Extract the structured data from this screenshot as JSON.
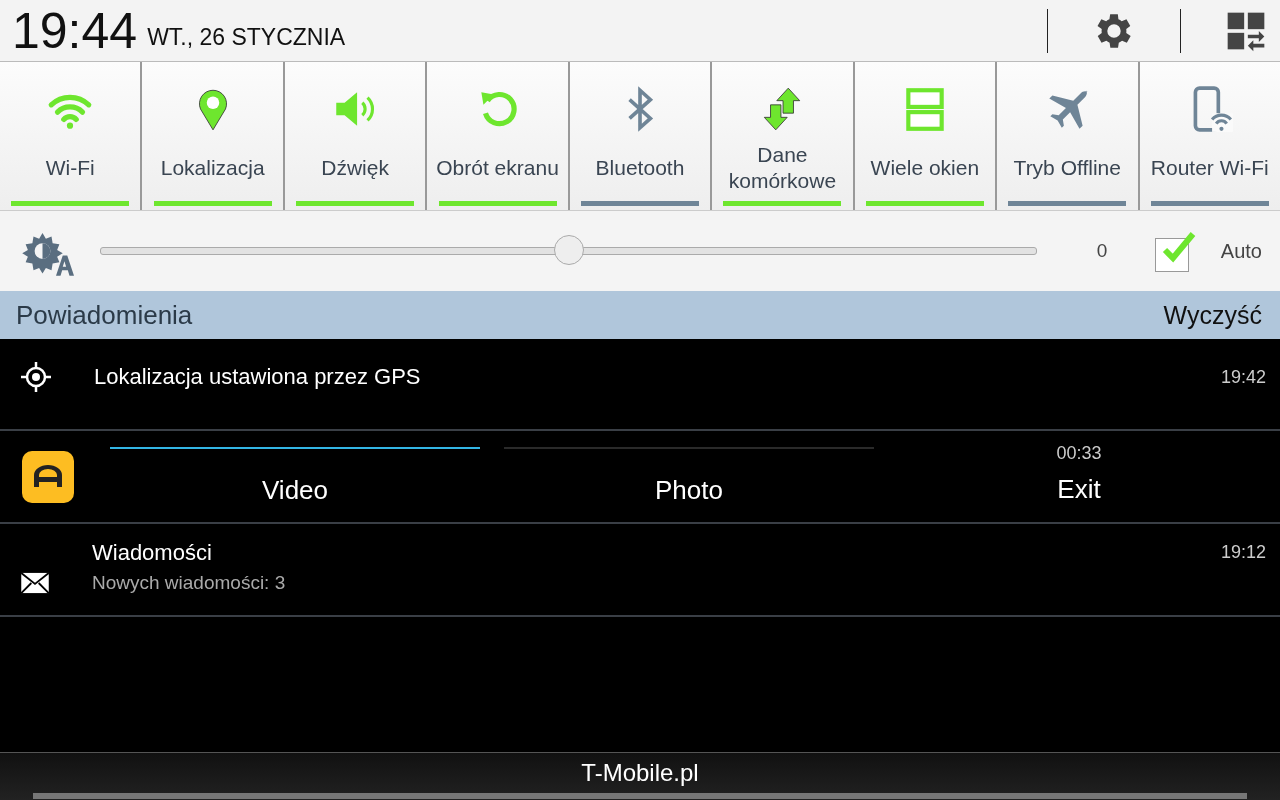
{
  "header": {
    "time": "19:44",
    "date": "WT., 26 STYCZNIA"
  },
  "toggles": [
    {
      "kind": "wifi",
      "label": "Wi-Fi",
      "on": true
    },
    {
      "kind": "location",
      "label": "Lokalizacja",
      "on": true
    },
    {
      "kind": "sound",
      "label": "Dźwięk",
      "on": true
    },
    {
      "kind": "rotate",
      "label": "Obrót ekranu",
      "on": true
    },
    {
      "kind": "bluetooth",
      "label": "Bluetooth",
      "on": false
    },
    {
      "kind": "data",
      "label": "Dane komórkowe",
      "on": true
    },
    {
      "kind": "multiwindow",
      "label": "Wiele okien",
      "on": true
    },
    {
      "kind": "airplane",
      "label": "Tryb Offline",
      "on": false
    },
    {
      "kind": "hotspot",
      "label": "Router Wi-Fi",
      "on": false
    }
  ],
  "brightness": {
    "level": 0.5,
    "reading": "0",
    "auto": {
      "label": "Auto",
      "checked": true
    }
  },
  "notifications": {
    "title": "Powiadomienia",
    "clear": "Wyczyść",
    "items": [
      {
        "kind": "gps",
        "title": "Lokalizacja ustawiona przez GPS",
        "time": "19:42"
      },
      {
        "kind": "recorder",
        "tabs": [
          {
            "label": "Video",
            "selected": true
          },
          {
            "label": "Photo",
            "selected": false
          }
        ],
        "elapsed": "00:33",
        "exit": "Exit"
      },
      {
        "kind": "message",
        "title": "Wiadomości",
        "subtitle": "Nowych wiadomości: 3",
        "time": "19:12"
      }
    ]
  },
  "carrier": "T-Mobile.pl"
}
